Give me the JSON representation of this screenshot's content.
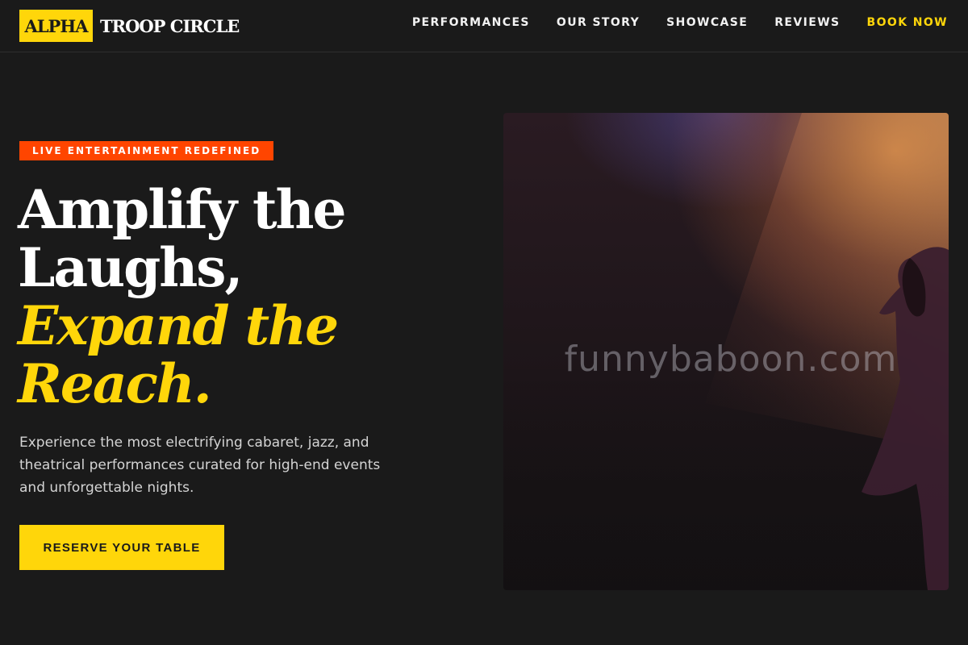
{
  "brand": {
    "logo_box": "ALPHA",
    "logo_text": "TROOP CIRCLE",
    "accent_color": "#ffd60a",
    "badge_color": "#ff4500"
  },
  "nav": {
    "items": [
      {
        "label": "PERFORMANCES"
      },
      {
        "label": "OUR STORY"
      },
      {
        "label": "SHOWCASE"
      },
      {
        "label": "REVIEWS"
      }
    ],
    "cta": "BOOK NOW"
  },
  "hero": {
    "badge": "LIVE ENTERTAINMENT REDEFINED",
    "headline_lines": [
      "Amplify the",
      "Laughs,"
    ],
    "headline_accent_lines": [
      "Expand the",
      "Reach."
    ],
    "subtext": "Experience the most electrifying cabaret, jazz, and theatrical performances curated for high-end events and unforgettable nights.",
    "button": "RESERVE YOUR TABLE",
    "image_watermark": "funnybaboon.com"
  }
}
